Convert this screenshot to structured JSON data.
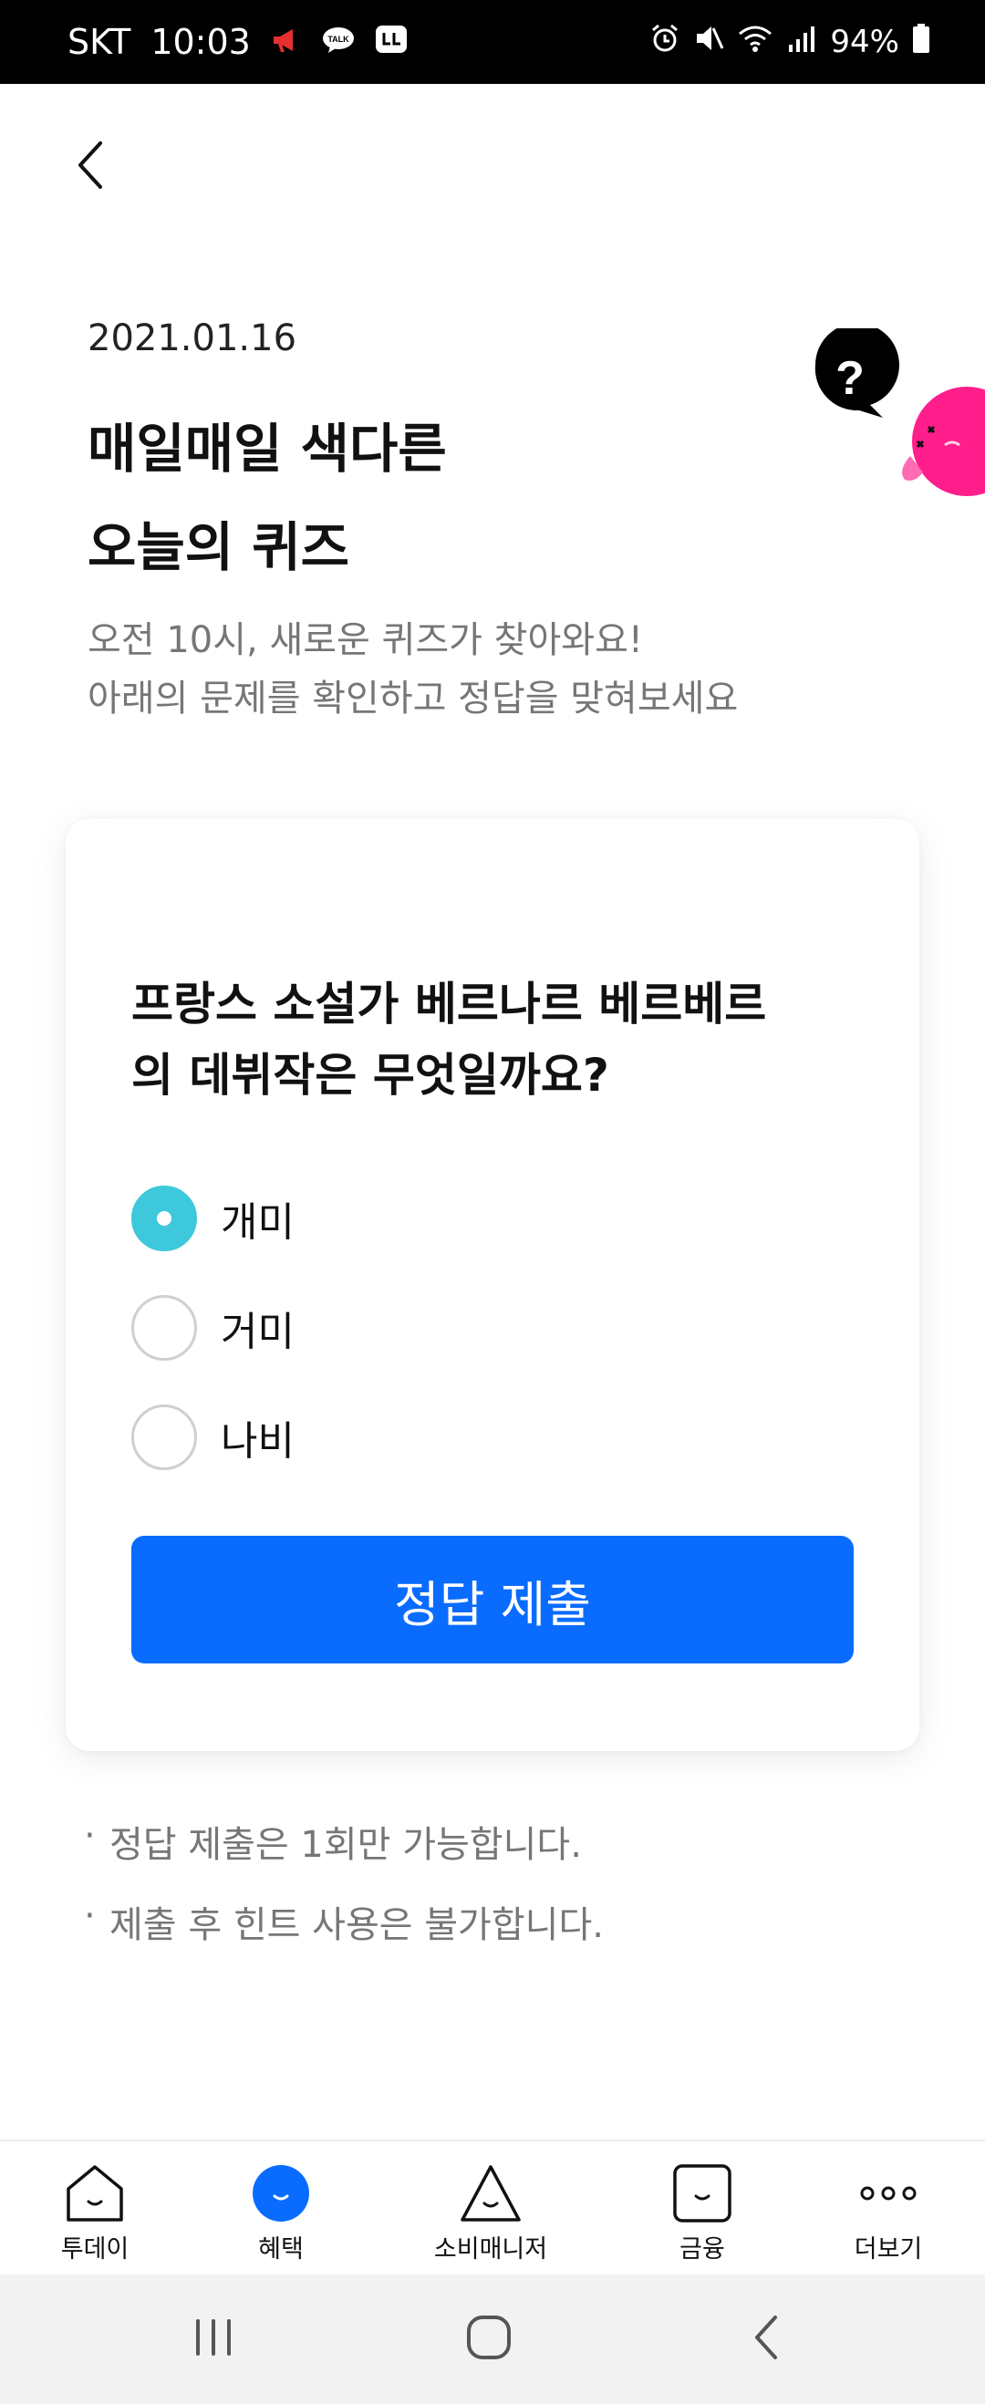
{
  "status_bar": {
    "carrier": "SKT",
    "time": "10:03",
    "battery": "94%",
    "left_icons": [
      "megaphone-icon",
      "kakaotalk-icon",
      "app-notification-icon"
    ],
    "right_icons": [
      "alarm-icon",
      "mute-icon",
      "wifi-icon",
      "signal-icon",
      "battery-icon"
    ]
  },
  "header": {
    "back_icon": "chevron-left-icon"
  },
  "hero": {
    "date": "2021.01.16",
    "title_line1": "매일매일 색다른",
    "title_line2": "오늘의 퀴즈",
    "subtitle_line1": "오전 10시, 새로운 퀴즈가 찾아와요!",
    "subtitle_line2": "아래의 문제를 확인하고 정답을 맞혀보세요",
    "mascot_bubble_text": "?"
  },
  "quiz": {
    "question_line1": "프랑스 소설가 베르나르 베르베르",
    "question_line2": "의 데뷔작은 무엇일까요?",
    "options": [
      {
        "label": "개미",
        "selected": true
      },
      {
        "label": "거미",
        "selected": false
      },
      {
        "label": "나비",
        "selected": false
      }
    ],
    "submit_label": "정답 제출"
  },
  "notes": [
    "정답 제출은 1회만 가능합니다.",
    "제출 후 힌트 사용은 불가합니다."
  ],
  "bottom_nav": {
    "items": [
      {
        "label": "투데이",
        "icon": "home-smile-icon",
        "active": false
      },
      {
        "label": "혜택",
        "icon": "benefit-smile-icon",
        "active": true
      },
      {
        "label": "소비매니저",
        "icon": "triangle-smile-icon",
        "active": false
      },
      {
        "label": "금융",
        "icon": "square-smile-icon",
        "active": false
      },
      {
        "label": "더보기",
        "icon": "more-dots-icon",
        "active": false
      }
    ]
  },
  "system_nav": [
    "recents-icon",
    "home-icon",
    "back-icon"
  ],
  "colors": {
    "accent_blue": "#0a6cff",
    "radio_selected": "#3ec8dc",
    "mascot_pink": "#ff1e8c"
  }
}
